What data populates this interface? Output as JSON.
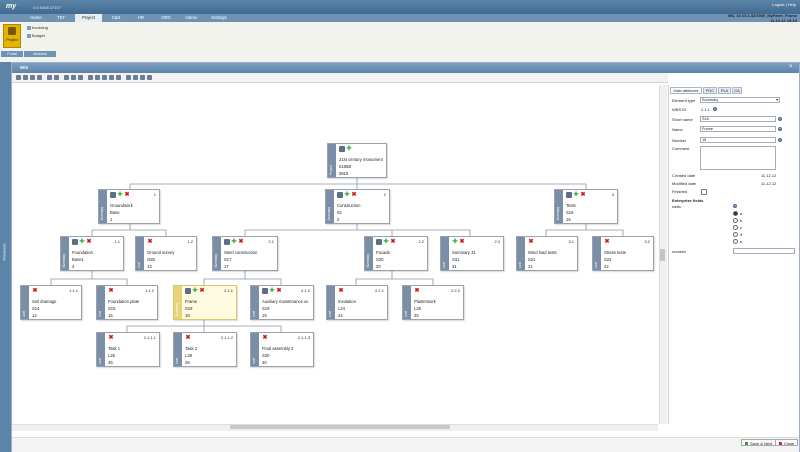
{
  "app": {
    "logo": "my",
    "version": "0.0.6405.37157",
    "toplinks": "Logout | Help",
    "server_line1": "MS, 10.13.1.32/1900_MyFarm_Frame",
    "server_line2": "11.12.12 15:15"
  },
  "menu": [
    "Home",
    "TET",
    "Project",
    "C&S",
    "HR",
    "ORG",
    "Admin",
    "Settings"
  ],
  "ribbon": {
    "project_button": "Project",
    "items": [
      "Invoicing",
      "Budget"
    ],
    "groups": [
      "Portal",
      "Modules"
    ]
  },
  "left_strip_label": "Processes",
  "window": {
    "title": "Win"
  },
  "nodes": [
    {
      "id": "n0",
      "type": "Project",
      "code": "",
      "l1": "21st century monument",
      "l2": "0185B",
      "l3": "0815"
    },
    {
      "id": "n1",
      "type": "Summary",
      "code": "1",
      "l1": "Groundwork",
      "l2": "Base",
      "l3": "1"
    },
    {
      "id": "n2",
      "type": "Summary",
      "code": "2",
      "l1": "Construction",
      "l2": "02",
      "l3": "2"
    },
    {
      "id": "n3",
      "type": "Summary",
      "code": "3",
      "l1": "Tests",
      "l2": "S16",
      "l3": "16"
    },
    {
      "id": "n4",
      "type": "Summary",
      "code": "1.1",
      "l1": "Foundation",
      "l2": "Base1",
      "l3": "4"
    },
    {
      "id": "n5",
      "type": "Leaf",
      "code": "1.2",
      "l1": "Ground survey",
      "l2": "G80",
      "l3": "13"
    },
    {
      "id": "n6",
      "type": "Summary",
      "code": "2.1",
      "l1": "Steel construction",
      "l2": "S17",
      "l3": "17"
    },
    {
      "id": "n7",
      "type": "Summary",
      "code": "2.2",
      "l1": "Facade",
      "l2": "S20",
      "l3": "20"
    },
    {
      "id": "n8",
      "type": "Leaf",
      "code": "2.3",
      "l1": "Summary 31",
      "l2": "S31",
      "l3": "31"
    },
    {
      "id": "n9",
      "type": "Leaf",
      "code": "3.1",
      "l1": "Wind load tests",
      "l2": "S21",
      "l3": "21"
    },
    {
      "id": "n10",
      "type": "Leaf",
      "code": "3.2",
      "l1": "Stress tests",
      "l2": "S22",
      "l3": "22"
    },
    {
      "id": "n11",
      "type": "Leaf",
      "code": "1.1.1",
      "l1": "Soil drainage",
      "l2": "S14",
      "l3": "14"
    },
    {
      "id": "n12",
      "type": "Leaf",
      "code": "1.1.2",
      "l1": "Foundation plate",
      "l2": "S15",
      "l3": "15"
    },
    {
      "id": "n13",
      "type": "Summary",
      "code": "2.1.1",
      "l1": "Frame",
      "l2": "S18",
      "l3": "18",
      "selected": true
    },
    {
      "id": "n14",
      "type": "Leaf",
      "code": "2.1.2",
      "l1": "Auxiliary maintenance ac",
      "l2": "S19",
      "l3": "19"
    },
    {
      "id": "n15",
      "type": "Leaf",
      "code": "2.2.1",
      "l1": "Insulation",
      "l2": "L24",
      "l3": "24"
    },
    {
      "id": "n16",
      "type": "Leaf",
      "code": "2.2.2",
      "l1": "Plasterwork",
      "l2": "L25",
      "l3": "25"
    },
    {
      "id": "n17",
      "type": "Leaf",
      "code": "2.1.1.1",
      "l1": "Task 1",
      "l2": "L26",
      "l3": "26"
    },
    {
      "id": "n18",
      "type": "Leaf",
      "code": "2.1.1.2",
      "l1": "Task 2",
      "l2": "L28",
      "l3": "28"
    },
    {
      "id": "n19",
      "type": "Leaf",
      "code": "2.1.1.3",
      "l1": "Final assembly 2",
      "l2": "S30",
      "l3": "30"
    }
  ],
  "panel": {
    "tabs": [
      "Main attributes",
      "POC",
      "PLA",
      "CA"
    ],
    "element_type_label": "Element type",
    "element_type_value": "Summary",
    "wbs_label": "WBS ID",
    "wbs_value": "2.1.1",
    "short_name_label": "Short name",
    "short_name_value": "S18",
    "name_label": "Name",
    "name_value": "Frame",
    "number_label": "Number",
    "number_value": "18",
    "comment_label": "Comment",
    "created_label": "Created date",
    "created_value": "11.12.12",
    "modified_label": "Modified date",
    "modified_value": "11.12.12",
    "finished_label": "Finished",
    "enterprise_label": "Enterprise fields",
    "radio_label": "radio",
    "radio_options": [
      "a",
      "b",
      "c",
      "d",
      "e"
    ],
    "numeric_label": "numeric"
  },
  "buttons": {
    "save_next": "Save & Next",
    "close": "Close"
  }
}
